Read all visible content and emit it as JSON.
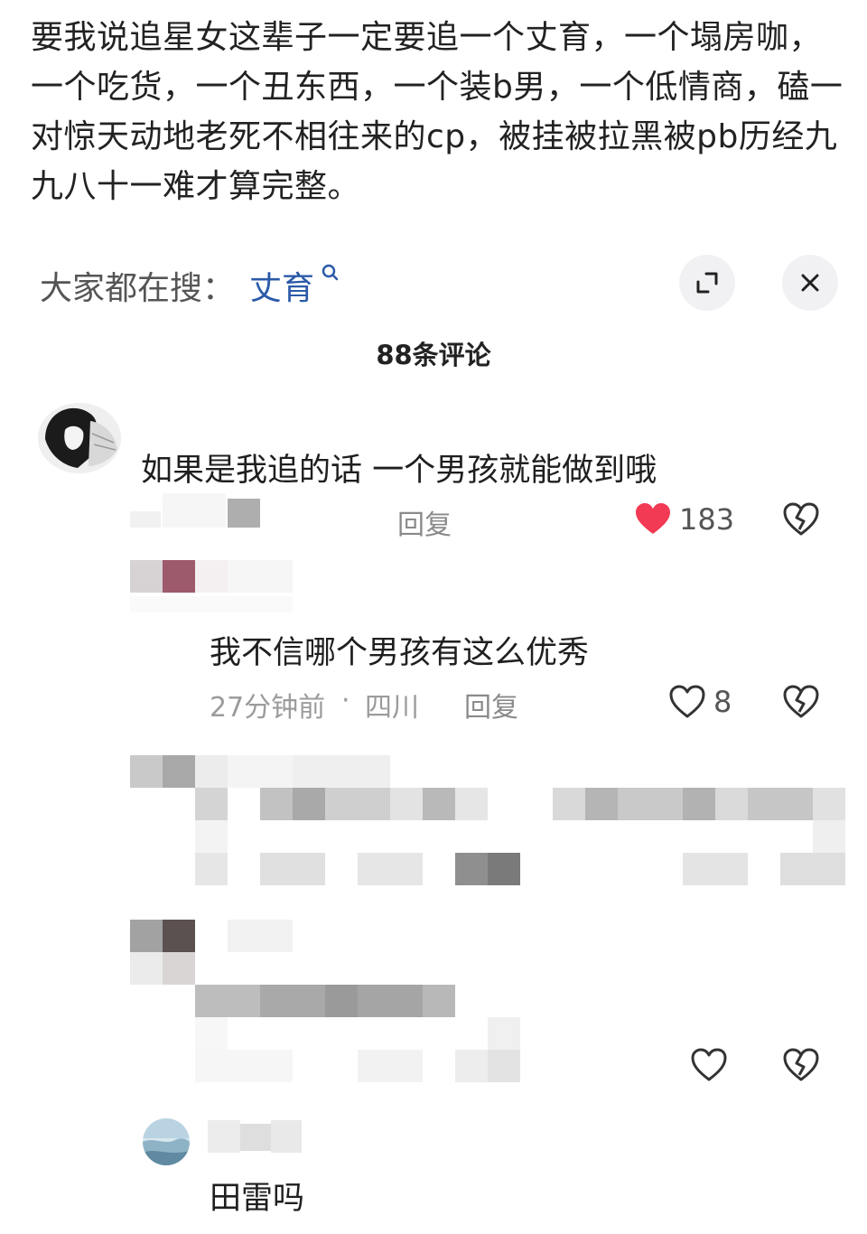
{
  "post": {
    "text": "要我说追星女这辈子一定要追一个丈育，一个塌房咖，一个吃货，一个丑东西，一个装b男，一个低情商，磕一对惊天动地老死不相往来的cp，被挂被拉黑被pb历经九九八十一难才算完整。"
  },
  "search": {
    "label": "大家都在搜：",
    "term": "丈育"
  },
  "comments_header": "88条评论",
  "comments": [
    {
      "text": "如果是我追的话 一个男孩就能做到哦",
      "reply_label": "回复",
      "likes": "183"
    },
    {
      "text": "我不信哪个男孩有这么优秀",
      "time": "27分钟前",
      "dot": "·",
      "location": "四川",
      "reply_label": "回复",
      "likes": "8"
    },
    {
      "text": "田雷吗"
    }
  ],
  "colors": {
    "accent_link": "#2b5aa8",
    "heart_red": "#f23a54",
    "meta_gray": "#9b9b9b"
  },
  "icons": [
    "search-icon",
    "expand-icon",
    "close-icon",
    "heart-filled-icon",
    "heart-outline-icon",
    "heart-broken-icon"
  ]
}
